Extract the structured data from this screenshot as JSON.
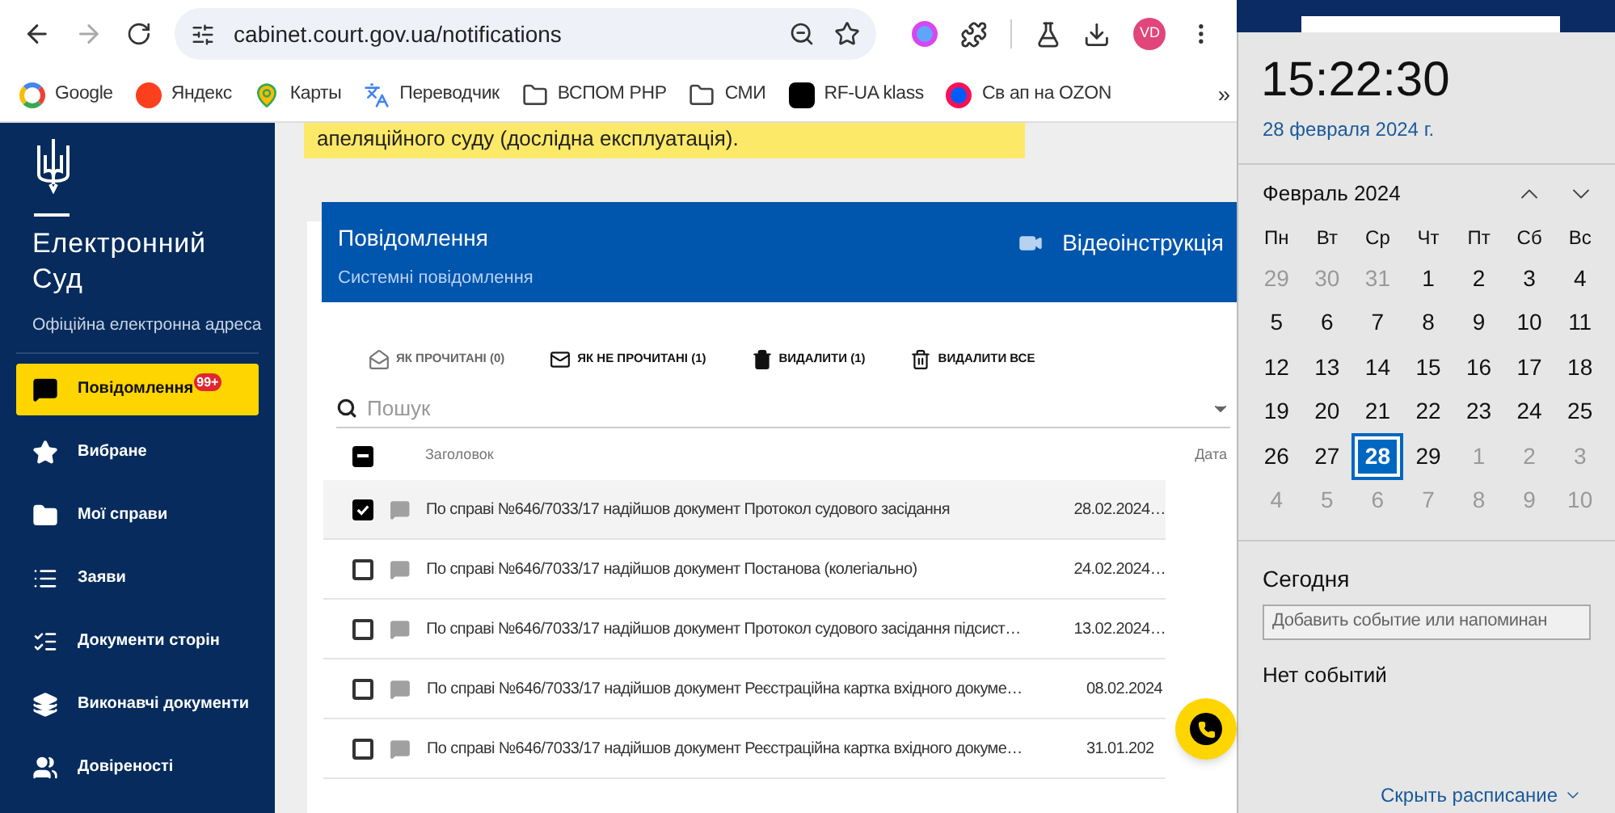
{
  "browser": {
    "url": "cabinet.court.gov.ua/notifications",
    "profile": "VD",
    "bookmarks": [
      {
        "label": "Google",
        "kind": "google"
      },
      {
        "label": "Яндекс",
        "kind": "yandex"
      },
      {
        "label": "Карты",
        "kind": "maps"
      },
      {
        "label": "Переводчик",
        "kind": "translate"
      },
      {
        "label": "ВСПОМ PHP",
        "kind": "folder"
      },
      {
        "label": "СМИ",
        "kind": "folder"
      },
      {
        "label": "RF-UA klass",
        "kind": "app"
      },
      {
        "label": "Св ап на OZON",
        "kind": "ozon"
      }
    ],
    "more": "»"
  },
  "sidebar": {
    "title": "Електронний Суд",
    "subtitle": "Офіційна електронна адреса",
    "items": [
      {
        "label": "Повідомлення",
        "kind": "message",
        "selected": true,
        "badge": "99+"
      },
      {
        "label": "Вибране",
        "kind": "star",
        "selected": false
      },
      {
        "label": "Мої справи",
        "kind": "folder",
        "selected": false
      },
      {
        "label": "Заяви",
        "kind": "list",
        "selected": false
      },
      {
        "label": "Документи сторін",
        "kind": "checklist",
        "selected": false
      },
      {
        "label": "Виконавчі документи",
        "kind": "layers",
        "selected": false
      },
      {
        "label": "Довіреності",
        "kind": "people",
        "selected": false
      }
    ]
  },
  "banner": "апеляційного суду (дослідна експлуатація).",
  "card": {
    "title": "Повідомлення",
    "subtitle": "Системні повідомлення",
    "video_link": "Відеоінструкція",
    "actions": [
      {
        "label": "ЯК ПРОЧИТАНІ (0)",
        "kind": "read",
        "disabled": true
      },
      {
        "label": "ЯК НЕ ПРОЧИТАНІ (1)",
        "kind": "unread",
        "disabled": false
      },
      {
        "label": "ВИДАЛИТИ (1)",
        "kind": "delete",
        "disabled": false
      },
      {
        "label": "ВИДАЛИТИ ВСЕ",
        "kind": "delete-all",
        "disabled": false
      }
    ],
    "search": {
      "placeholder": "Пошук"
    },
    "table": {
      "select_all": {
        "partial": true
      },
      "columns": [
        "Заголовок",
        "Дата"
      ],
      "rows": [
        {
          "title": "По справі №646/7033/17 надійшов документ Протокол судового засідання",
          "date": "28.02.2024…",
          "checked": true
        },
        {
          "title": "По справі №646/7033/17 надійшов документ Постанова (колегіально)",
          "date": "24.02.2024…",
          "checked": false
        },
        {
          "title": "По справі №646/7033/17 надійшов документ Протокол судового засідання підсист…",
          "date": "13.02.2024…",
          "checked": false
        },
        {
          "title": "По справі №646/7033/17 надійшов документ Реєстраційна картка вхідного докуме…",
          "date": "08.02.2024",
          "checked": false
        },
        {
          "title": "По справі №646/7033/17 надійшов документ Реєстраційна картка вхідного докуме…",
          "date": "31.01.202",
          "checked": false
        }
      ]
    }
  },
  "calendar": {
    "time": "15:22:30",
    "date": "28 февраля 2024 г.",
    "month": "Февраль 2024",
    "weekdays": [
      "Пн",
      "Вт",
      "Ср",
      "Чт",
      "Пт",
      "Сб",
      "Вс"
    ],
    "days": [
      {
        "label": "29",
        "muted": true,
        "selected": false
      },
      {
        "label": "30",
        "muted": true,
        "selected": false
      },
      {
        "label": "31",
        "muted": true,
        "selected": false
      },
      {
        "label": "1",
        "muted": false,
        "selected": false
      },
      {
        "label": "2",
        "muted": false,
        "selected": false
      },
      {
        "label": "3",
        "muted": false,
        "selected": false
      },
      {
        "label": "4",
        "muted": false,
        "selected": false
      },
      {
        "label": "5",
        "muted": false,
        "selected": false
      },
      {
        "label": "6",
        "muted": false,
        "selected": false
      },
      {
        "label": "7",
        "muted": false,
        "selected": false
      },
      {
        "label": "8",
        "muted": false,
        "selected": false
      },
      {
        "label": "9",
        "muted": false,
        "selected": false
      },
      {
        "label": "10",
        "muted": false,
        "selected": false
      },
      {
        "label": "11",
        "muted": false,
        "selected": false
      },
      {
        "label": "12",
        "muted": false,
        "selected": false
      },
      {
        "label": "13",
        "muted": false,
        "selected": false
      },
      {
        "label": "14",
        "muted": false,
        "selected": false
      },
      {
        "label": "15",
        "muted": false,
        "selected": false
      },
      {
        "label": "16",
        "muted": false,
        "selected": false
      },
      {
        "label": "17",
        "muted": false,
        "selected": false
      },
      {
        "label": "18",
        "muted": false,
        "selected": false
      },
      {
        "label": "19",
        "muted": false,
        "selected": false
      },
      {
        "label": "20",
        "muted": false,
        "selected": false
      },
      {
        "label": "21",
        "muted": false,
        "selected": false
      },
      {
        "label": "22",
        "muted": false,
        "selected": false
      },
      {
        "label": "23",
        "muted": false,
        "selected": false
      },
      {
        "label": "24",
        "muted": false,
        "selected": false
      },
      {
        "label": "25",
        "muted": false,
        "selected": false
      },
      {
        "label": "26",
        "muted": false,
        "selected": false
      },
      {
        "label": "27",
        "muted": false,
        "selected": false
      },
      {
        "label": "28",
        "muted": false,
        "selected": true
      },
      {
        "label": "29",
        "muted": false,
        "selected": false
      },
      {
        "label": "1",
        "muted": true,
        "selected": false
      },
      {
        "label": "2",
        "muted": true,
        "selected": false
      },
      {
        "label": "3",
        "muted": true,
        "selected": false
      },
      {
        "label": "4",
        "muted": true,
        "selected": false
      },
      {
        "label": "5",
        "muted": true,
        "selected": false
      },
      {
        "label": "6",
        "muted": true,
        "selected": false
      },
      {
        "label": "7",
        "muted": true,
        "selected": false
      },
      {
        "label": "8",
        "muted": true,
        "selected": false
      },
      {
        "label": "9",
        "muted": true,
        "selected": false
      },
      {
        "label": "10",
        "muted": true,
        "selected": false
      }
    ],
    "today_heading": "Сегодня",
    "event_placeholder": "Добавить событие или напоминан",
    "no_events": "Нет событий",
    "hide_link": "Скрыть расписание"
  }
}
